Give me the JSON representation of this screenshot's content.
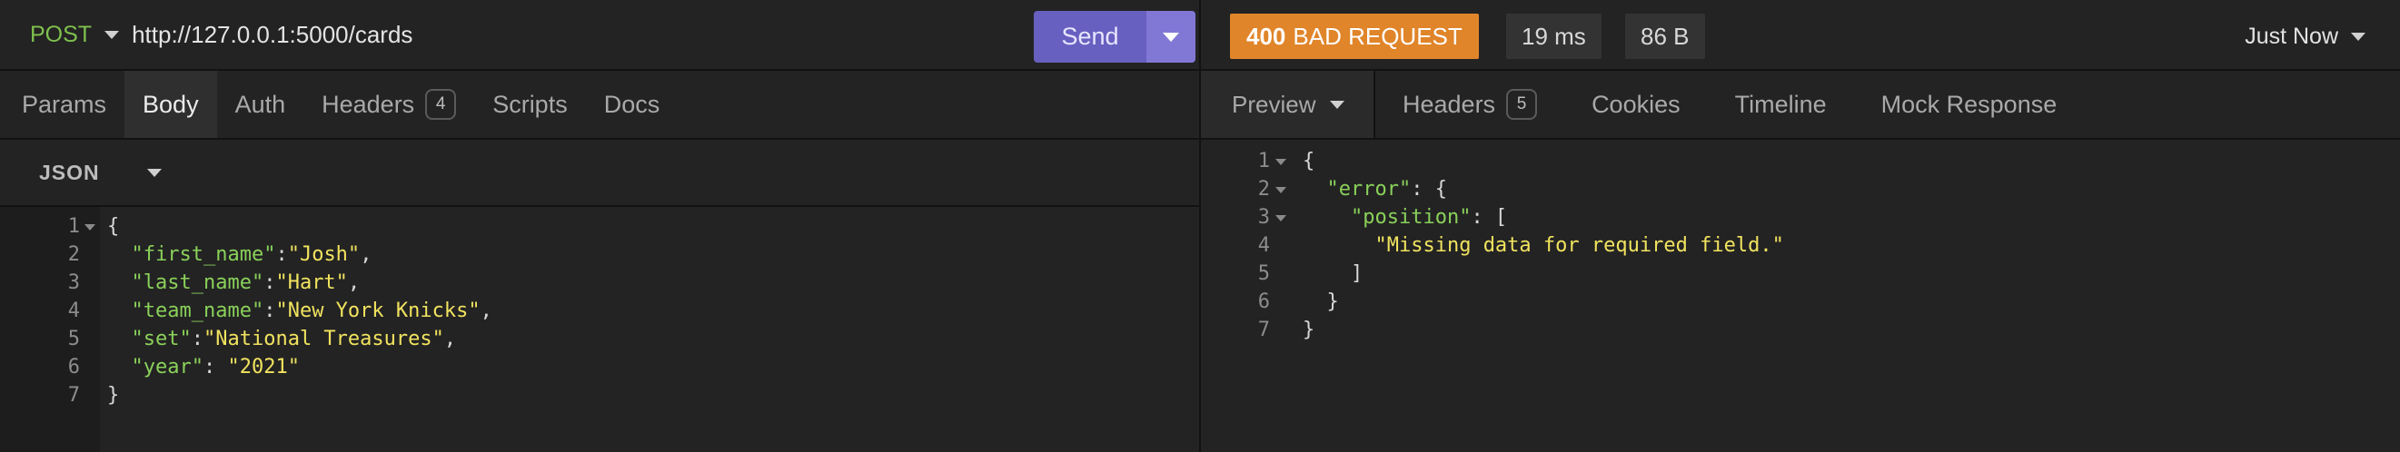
{
  "request": {
    "method": "POST",
    "url": "http://127.0.0.1:5000/cards",
    "send_label": "Send",
    "tabs": [
      {
        "label": "Params"
      },
      {
        "label": "Body"
      },
      {
        "label": "Auth"
      },
      {
        "label": "Headers",
        "count": "4"
      },
      {
        "label": "Scripts"
      },
      {
        "label": "Docs"
      }
    ],
    "active_tab": "Body",
    "body_type": "JSON",
    "body_lines": [
      {
        "n": "1",
        "parts": [
          {
            "t": "{",
            "c": "punc"
          }
        ],
        "fold": true
      },
      {
        "n": "2",
        "parts": [
          {
            "t": "  ",
            "c": "punc"
          },
          {
            "t": "\"first_name\"",
            "c": "key"
          },
          {
            "t": ":",
            "c": "punc"
          },
          {
            "t": "\"Josh\"",
            "c": "str"
          },
          {
            "t": ",",
            "c": "punc"
          }
        ]
      },
      {
        "n": "3",
        "parts": [
          {
            "t": "  ",
            "c": "punc"
          },
          {
            "t": "\"last_name\"",
            "c": "key"
          },
          {
            "t": ":",
            "c": "punc"
          },
          {
            "t": "\"Hart\"",
            "c": "str"
          },
          {
            "t": ",",
            "c": "punc"
          }
        ]
      },
      {
        "n": "4",
        "parts": [
          {
            "t": "  ",
            "c": "punc"
          },
          {
            "t": "\"team_name\"",
            "c": "key"
          },
          {
            "t": ":",
            "c": "punc"
          },
          {
            "t": "\"New York Knicks\"",
            "c": "str"
          },
          {
            "t": ",",
            "c": "punc"
          }
        ]
      },
      {
        "n": "5",
        "parts": [
          {
            "t": "  ",
            "c": "punc"
          },
          {
            "t": "\"set\"",
            "c": "key"
          },
          {
            "t": ":",
            "c": "punc"
          },
          {
            "t": "\"National Treasures\"",
            "c": "str"
          },
          {
            "t": ",",
            "c": "punc"
          }
        ]
      },
      {
        "n": "6",
        "parts": [
          {
            "t": "  ",
            "c": "punc"
          },
          {
            "t": "\"year\"",
            "c": "key"
          },
          {
            "t": ": ",
            "c": "punc"
          },
          {
            "t": "\"2021\"",
            "c": "str"
          }
        ]
      },
      {
        "n": "7",
        "parts": [
          {
            "t": "}",
            "c": "punc"
          }
        ]
      }
    ]
  },
  "response": {
    "status_code": "400",
    "status_text": "BAD REQUEST",
    "time": "19 ms",
    "size": "86 B",
    "history_label": "Just Now",
    "preview_label": "Preview",
    "tabs": [
      {
        "label": "Headers",
        "count": "5"
      },
      {
        "label": "Cookies"
      },
      {
        "label": "Timeline"
      },
      {
        "label": "Mock Response"
      }
    ],
    "body_lines": [
      {
        "n": "1",
        "parts": [
          {
            "t": "{",
            "c": "punc"
          }
        ],
        "fold": true
      },
      {
        "n": "2",
        "parts": [
          {
            "t": "  ",
            "c": "punc"
          },
          {
            "t": "\"error\"",
            "c": "key"
          },
          {
            "t": ": {",
            "c": "punc"
          }
        ],
        "fold": true
      },
      {
        "n": "3",
        "parts": [
          {
            "t": "    ",
            "c": "punc"
          },
          {
            "t": "\"position\"",
            "c": "key"
          },
          {
            "t": ": [",
            "c": "punc"
          }
        ],
        "fold": true
      },
      {
        "n": "4",
        "parts": [
          {
            "t": "      ",
            "c": "punc"
          },
          {
            "t": "\"Missing data for required field.\"",
            "c": "str"
          }
        ]
      },
      {
        "n": "5",
        "parts": [
          {
            "t": "    ]",
            "c": "punc"
          }
        ]
      },
      {
        "n": "6",
        "parts": [
          {
            "t": "  }",
            "c": "punc"
          }
        ]
      },
      {
        "n": "7",
        "parts": [
          {
            "t": "}",
            "c": "punc"
          }
        ]
      }
    ]
  },
  "colors": {
    "method": "#7fc04e",
    "send": "#6860c0",
    "status_error": "#e0852a",
    "json_key": "#8ad15a",
    "json_string": "#f1e35f"
  }
}
